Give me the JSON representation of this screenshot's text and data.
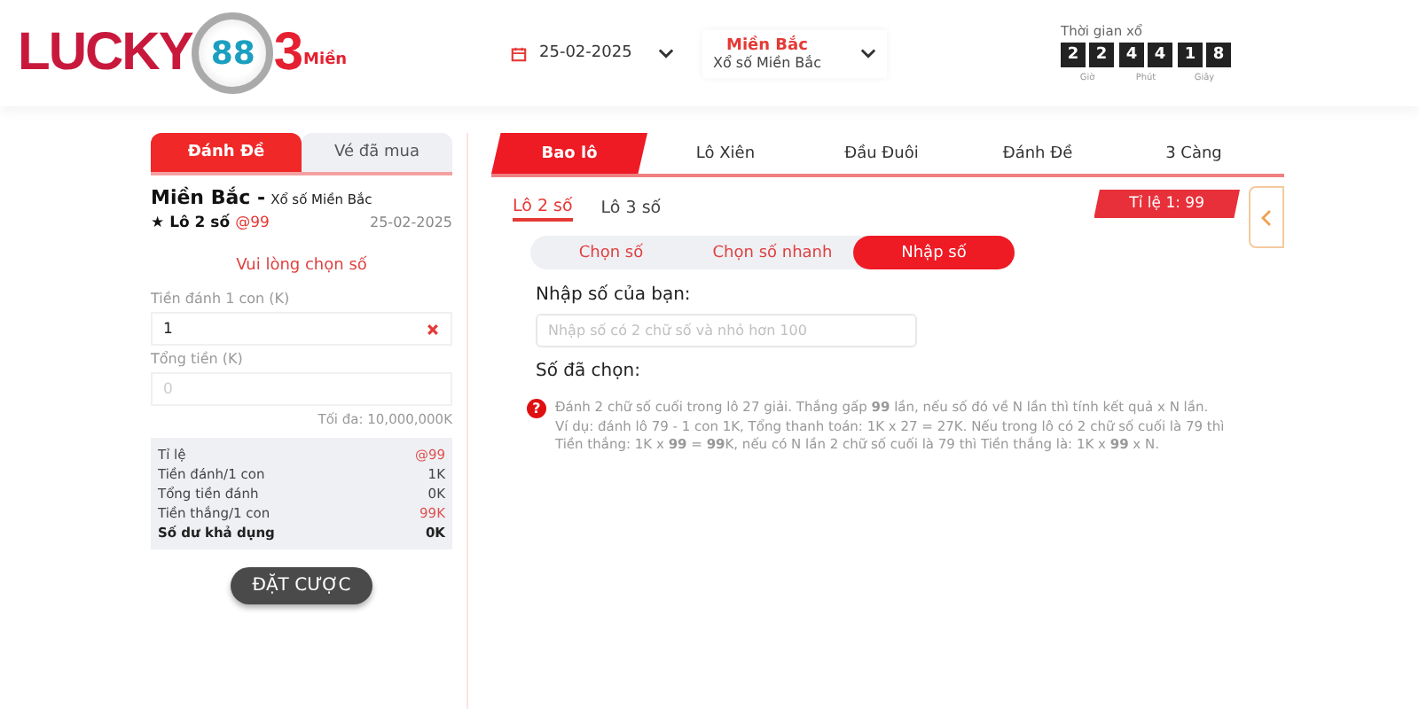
{
  "logo": {
    "word": "LUCKY",
    "badge": "88",
    "number": "3",
    "suffix": "Miền"
  },
  "date_picker": {
    "value": "25-02-2025"
  },
  "region_picker": {
    "title": "Miền Bắc",
    "subtitle": "Xổ số Miền Bắc"
  },
  "countdown": {
    "label": "Thời gian xổ",
    "units": [
      {
        "digits": [
          "2",
          "2"
        ],
        "label": "Giờ"
      },
      {
        "digits": [
          "4",
          "4"
        ],
        "label": "Phút"
      },
      {
        "digits": [
          "1",
          "8"
        ],
        "label": "Giây"
      }
    ]
  },
  "left_panel": {
    "tabs": [
      {
        "label": "Đánh Đề",
        "selected": true
      },
      {
        "label": "Vé đã mua",
        "selected": false
      }
    ],
    "region": "Miền Bắc -",
    "region_sub": "Xổ số Miền Bắc",
    "bet_type": "★ Lô 2 số",
    "odds": "@99",
    "date": "25-02-2025",
    "prompt": "Vui lòng chọn số",
    "stake_label": "Tiền đánh 1 con (K)",
    "stake_value": "1",
    "total_label": "Tổng tiền (K)",
    "total_placeholder": "0",
    "max_note": "Tối đa: 10,000,000K",
    "summary": [
      {
        "label": "Tỉ lệ",
        "value": "@99",
        "kind": "red"
      },
      {
        "label": "Tiền đánh/1 con",
        "value": "1K",
        "kind": "plain"
      },
      {
        "label": "Tổng tiền đánh",
        "value": "0K",
        "kind": "plain"
      },
      {
        "label": "Tiền thắng/1 con",
        "value": "99K",
        "kind": "red"
      },
      {
        "label": "Số dư khả dụng",
        "value": "0K",
        "kind": "total"
      }
    ],
    "submit": "ĐẶT CƯỢC"
  },
  "main_panel": {
    "tabs": [
      {
        "label": "Bao lô",
        "selected": true
      },
      {
        "label": "Lô Xiên",
        "selected": false
      },
      {
        "label": "Đầu Đuôi",
        "selected": false
      },
      {
        "label": "Đánh Đề",
        "selected": false
      },
      {
        "label": "3 Càng",
        "selected": false
      }
    ],
    "sub_tabs": [
      {
        "label": "Lô 2 số",
        "selected": true
      },
      {
        "label": "Lô 3 số",
        "selected": false
      }
    ],
    "ratio": "Tỉ lệ 1: 99",
    "modes": [
      {
        "label": "Chọn số",
        "selected": false
      },
      {
        "label": "Chọn số nhanh",
        "selected": false
      },
      {
        "label": "Nhập số",
        "selected": true
      }
    ],
    "input_label": "Nhập số của bạn:",
    "input_placeholder": "Nhập số có 2 chữ số và nhỏ hơn 100",
    "chosen_label": "Số đã chọn:",
    "help_mark": "?",
    "help": [
      "Đánh 2 chữ số cuối trong lô 27 giải. Thắng gấp **99** lần, nếu số đó về N lần thì tính kết quả x N lần.",
      "Ví dụ: đánh lô 79 - 1 con 1K, Tổng thanh toán: 1K x 27 = 27K. Nếu trong lô có 2 chữ số cuối là 79 thì Tiền thắng: 1K x **99** = **99**K, nếu có N lần 2 chữ số cuối là 79 thì Tiền thắng là: 1K x **99** x N."
    ]
  }
}
